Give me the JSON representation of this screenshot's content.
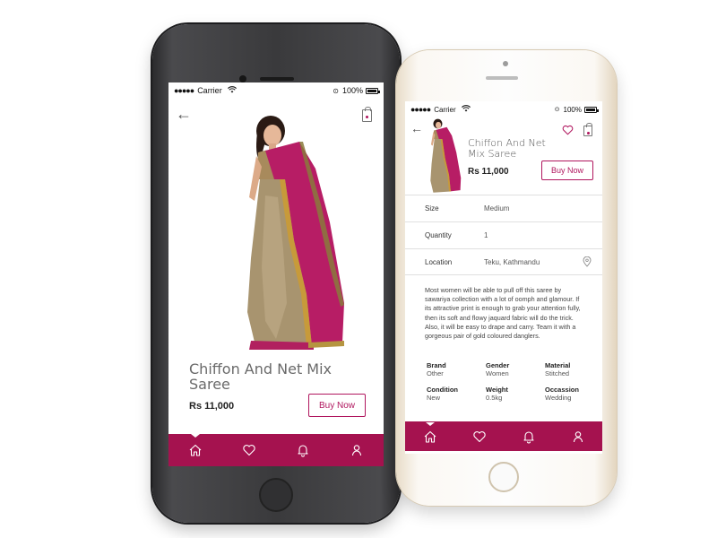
{
  "colors": {
    "accent": "#a5124f",
    "buy_border": "#b0165e"
  },
  "status_bar": {
    "carrier": "Carrier",
    "battery": "100%"
  },
  "dark_phone": {
    "product_title": "Chiffon And Net Mix Saree",
    "price": "Rs 11,000",
    "buy_label": "Buy Now",
    "tabs": [
      {
        "icon": "home-icon",
        "active": true
      },
      {
        "icon": "heart-icon",
        "active": false
      },
      {
        "icon": "bell-icon",
        "active": false
      },
      {
        "icon": "user-icon",
        "active": false
      }
    ]
  },
  "light_phone": {
    "product_title": "Chiffon And Net Mix Saree",
    "price": "Rs 11,000",
    "buy_label": "Buy Now",
    "rows": [
      {
        "label": "Size",
        "value": "Medium"
      },
      {
        "label": "Quantity",
        "value": "1"
      },
      {
        "label": "Location",
        "value": "Teku, Kathmandu"
      }
    ],
    "description": "Most women will be able to pull off this saree by sawariya collection with a lot of oomph and glamour. If its attractive print is enough to grab your attention fully, then its soft and flowy jaquard fabric will do the trick. Also, it will be easy to drape and carry. Team it with a gorgeous pair of gold coloured danglers.",
    "attributes": [
      {
        "key": "Brand",
        "value": "Other"
      },
      {
        "key": "Gender",
        "value": "Women"
      },
      {
        "key": "Material",
        "value": "Stitched"
      },
      {
        "key": "Condition",
        "value": "New"
      },
      {
        "key": "Weight",
        "value": "0.5kg"
      },
      {
        "key": "Occassion",
        "value": "Wedding"
      }
    ]
  }
}
